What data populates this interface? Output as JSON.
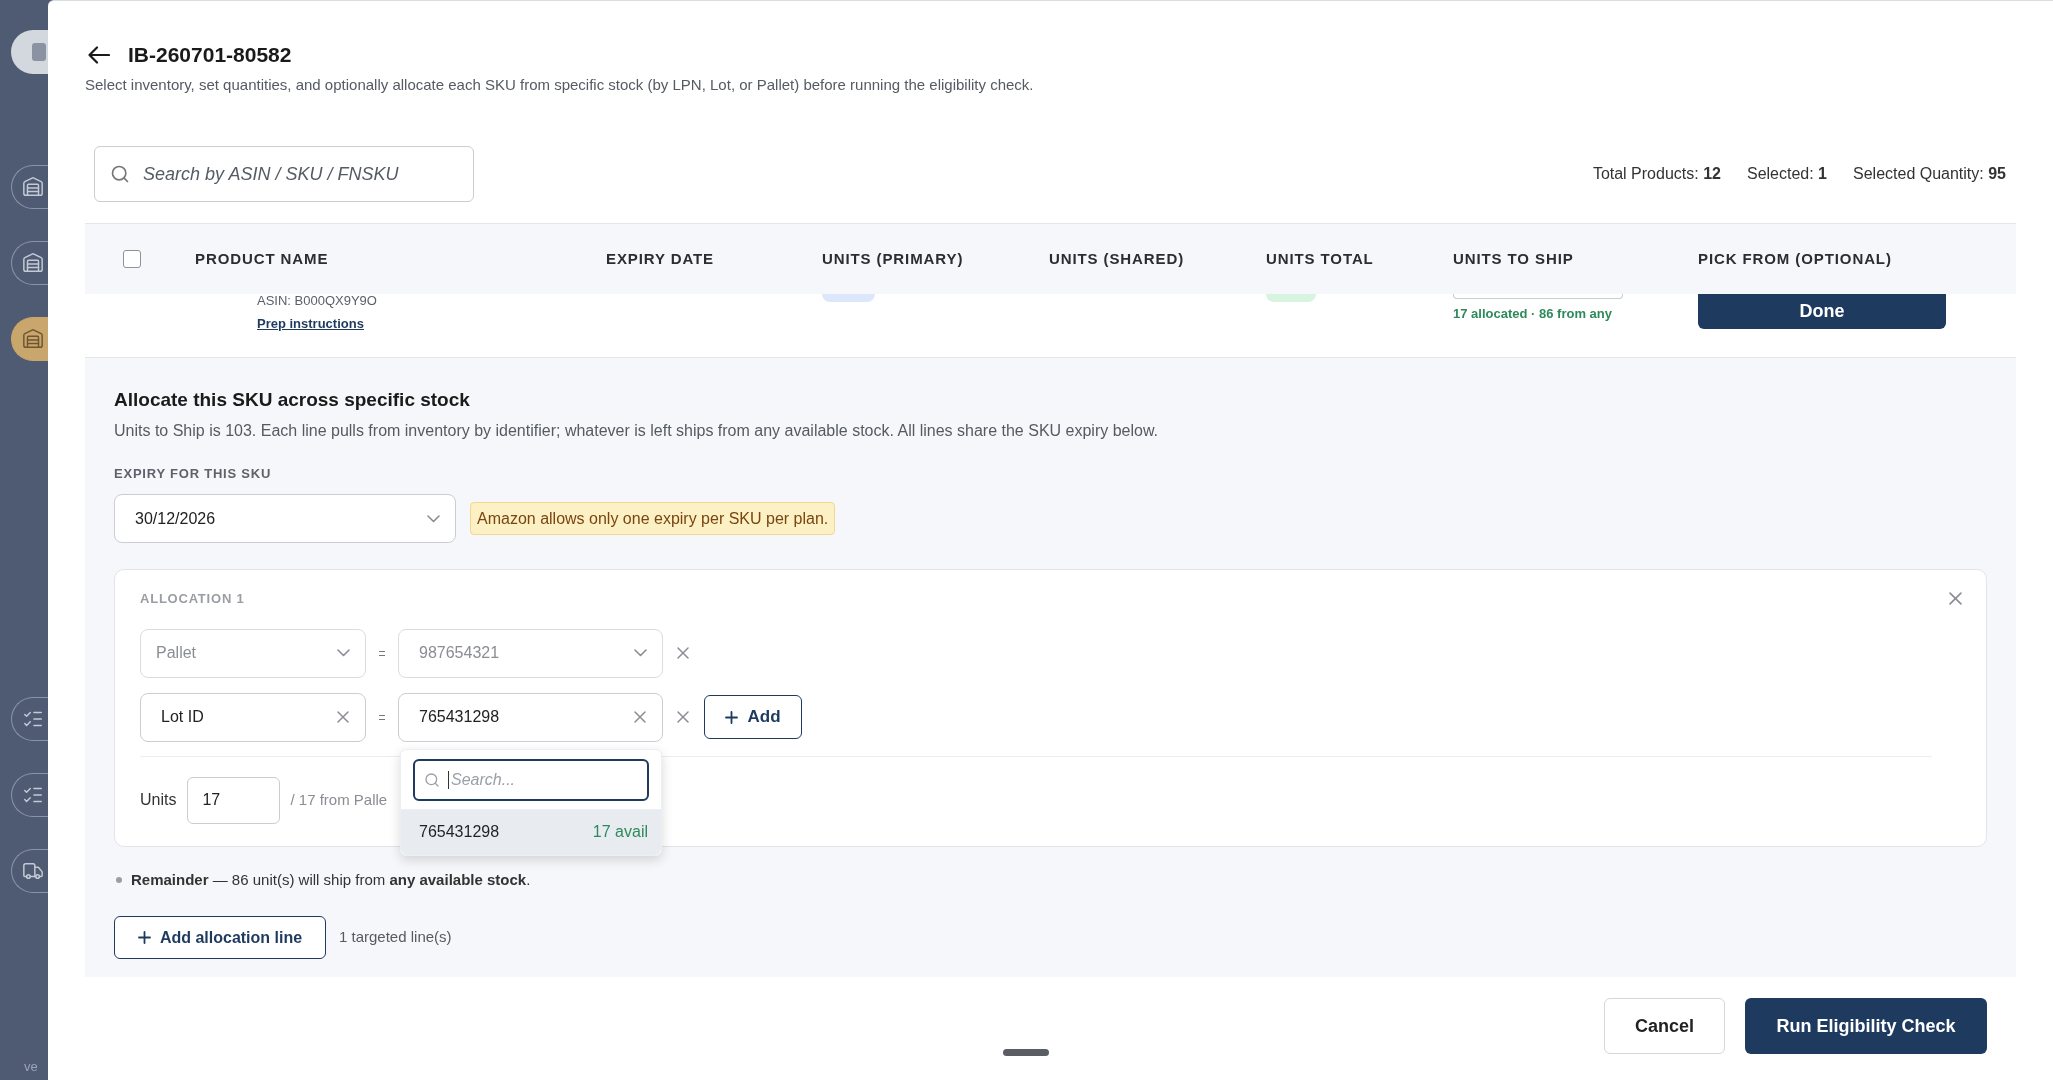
{
  "sidebar": {
    "items": [
      {
        "selected": false
      },
      {
        "selected": false
      },
      {
        "selected": true
      },
      {
        "selected": false
      },
      {
        "selected": false
      },
      {
        "selected": false
      }
    ],
    "footer": "ve"
  },
  "header": {
    "title": "IB-260701-80582",
    "subtitle": "Select inventory, set quantities, and optionally allocate each SKU from specific stock (by LPN, Lot, or Pallet) before running the eligibility check."
  },
  "search": {
    "placeholder": "Search by ASIN / SKU / FNSKU"
  },
  "summary": [
    "Total Products: **12**",
    "Selected: **1**",
    "Selected Quantity: **95**"
  ],
  "table": {
    "select_all": {
      "checked": false
    },
    "columns": [
      "PRODUCT NAME",
      "EXPIRY DATE",
      "UNITS (PRIMARY)",
      "UNITS (SHARED)",
      "UNITS TOTAL",
      "UNITS TO SHIP",
      "PICK FROM (OPTIONAL)"
    ],
    "rows": [
      {
        "asin": "ASIN: B000QX9Y9O",
        "link": "Prep instructions",
        "ship_note": "17 allocated · 86 from any",
        "action": "Done"
      }
    ]
  },
  "allocation_panel": {
    "title": "Allocate this SKU across specific stock",
    "description": "Units to Ship is 103. Each line pulls from inventory by identifier; whatever is left ships from any available stock. All lines share the SKU expiry below.",
    "expiry_label": "EXPIRY FOR THIS SKU",
    "expiry_value": "30/12/2026",
    "expiry_notice": "Amazon allows only one expiry per SKU per plan.",
    "allocations": [
      {
        "title": "ALLOCATION 1",
        "criteria": [
          {
            "kind": "select",
            "field": "Pallet",
            "value": "987654321"
          },
          {
            "kind": "clearable",
            "field": "Lot ID",
            "value": "765431298",
            "add_button": "Add",
            "dropdown": {
              "placeholder": "Search...",
              "options": [
                {
                  "value": "765431298",
                  "availability": "17 avail",
                  "selected": true
                }
              ]
            }
          }
        ],
        "units_label": "Units",
        "units_value": "17",
        "units_note": "/ 17 from Palle"
      }
    ],
    "remainder": "**Remainder** — 86 unit(s) will ship from **any available stock**.",
    "add_line_button": "Add allocation line",
    "line_count": "1 targeted line(s)"
  },
  "footer": {
    "buttons": [
      {
        "label": "Cancel",
        "kind": "secondary"
      },
      {
        "label": "Run Eligibility Check",
        "kind": "primary"
      }
    ]
  }
}
